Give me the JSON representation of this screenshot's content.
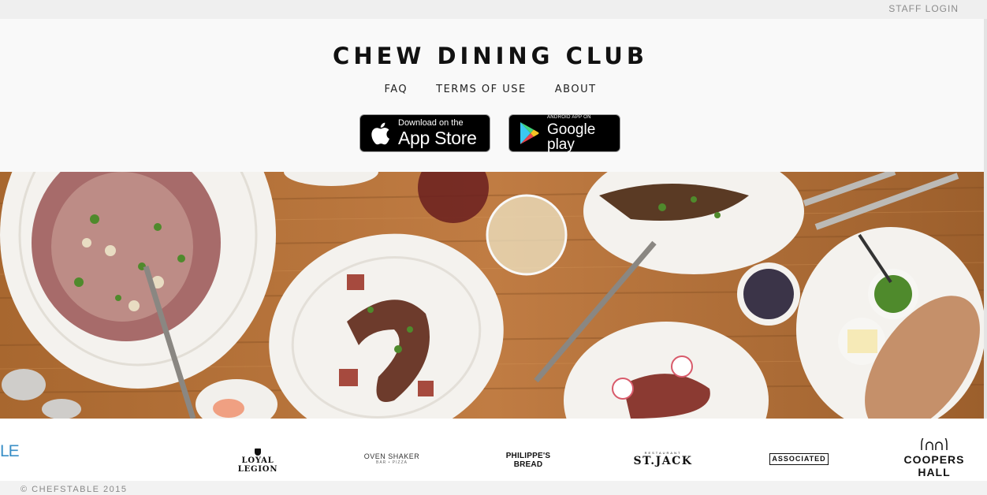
{
  "topbar": {
    "staff_login": "STAFF LOGIN"
  },
  "header": {
    "logo": "CHEW DINING CLUB",
    "nav": [
      "FAQ",
      "TERMS OF USE",
      "ABOUT"
    ],
    "app_store": {
      "small": "Download on the",
      "big": "App Store"
    },
    "google_play": {
      "small": "ANDROID APP ON",
      "big": "Google play"
    }
  },
  "partners": {
    "le": "LE",
    "loyal_legion": {
      "name": "LOYAL LEGION"
    },
    "oven_shaker": {
      "name": "OVEN SHAKER",
      "sub": "BAR • PIZZA"
    },
    "philippes": {
      "line1": "PHILIPPE'S",
      "line2": "BREAD"
    },
    "st_jack": {
      "sub": "RESTAURANT",
      "name": "ST.JACK"
    },
    "associated": "ASSOCIATED",
    "coopers": {
      "line1": "COOPERS",
      "line2": "HALL"
    }
  },
  "footer": {
    "copyright": "© CHEFSTABLE 2015"
  },
  "colors": {
    "table_wood": "#b7753e",
    "plate": "#f4f2ee",
    "accent_le": "#3a8fc7"
  },
  "icons": [
    "apple-icon",
    "google-play-icon",
    "coopers-arches-icon"
  ]
}
